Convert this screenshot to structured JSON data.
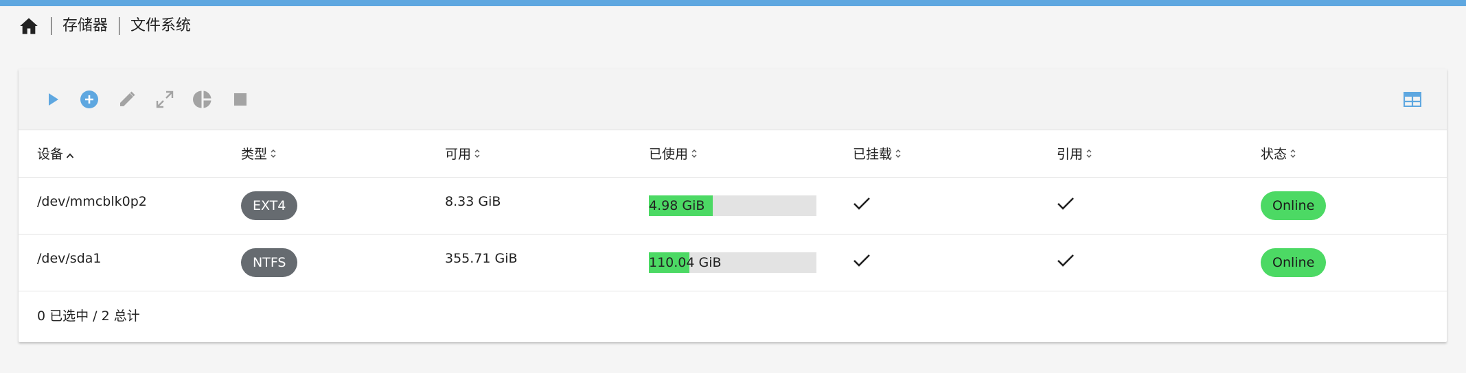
{
  "breadcrumb": {
    "items": [
      "存储器",
      "文件系统"
    ]
  },
  "toolbar": {
    "icons": [
      "play-icon",
      "add-circle-icon",
      "edit-icon",
      "expand-icon",
      "pie-chart-icon",
      "stop-icon"
    ],
    "right_icon": "table-view-icon",
    "colors": {
      "active": "#5ea7e0",
      "disabled": "#9e9e9e"
    }
  },
  "table": {
    "columns": [
      {
        "label": "设备",
        "sort": "asc"
      },
      {
        "label": "类型",
        "sort": "none"
      },
      {
        "label": "可用",
        "sort": "none"
      },
      {
        "label": "已使用",
        "sort": "none"
      },
      {
        "label": "已挂载",
        "sort": "none"
      },
      {
        "label": "引用",
        "sort": "none"
      },
      {
        "label": "状态",
        "sort": "none"
      }
    ],
    "rows": [
      {
        "device": "/dev/mmcblk0p2",
        "type": "EXT4",
        "available": "8.33 GiB",
        "used": "4.98 GiB",
        "used_fraction": 0.38,
        "mounted": true,
        "referenced": true,
        "status": "Online"
      },
      {
        "device": "/dev/sda1",
        "type": "NTFS",
        "available": "355.71 GiB",
        "used": "110.04 GiB",
        "used_fraction": 0.24,
        "mounted": true,
        "referenced": true,
        "status": "Online"
      }
    ]
  },
  "footer": {
    "summary": "0 已选中 / 2 总计"
  },
  "colors": {
    "accent": "#5ea7e0",
    "online": "#4cd964",
    "chip_type": "#666b70"
  }
}
